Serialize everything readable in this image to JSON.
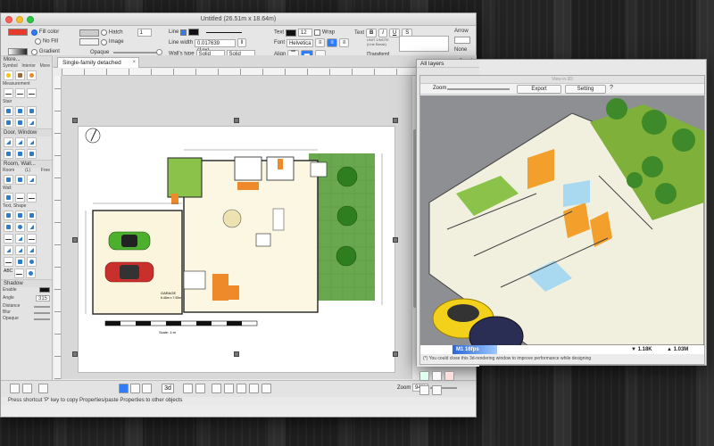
{
  "app": {
    "title": "Untitled (26.51m x 18.64m)",
    "status": "Press shortcut 'P' key to copy Properties/paste Properties to other objects"
  },
  "topbar": {
    "fill_color_label": "Fill color",
    "no_fill_label": "No Fill",
    "gradient_label": "Gradient",
    "hatch_label": "Hatch",
    "image_label": "Image",
    "opaque_label": "Opaque",
    "line_label": "Line",
    "line_width_label": "Line width",
    "line_width_value": "0.017639 (1px)",
    "walls_type_label": "Wall's type",
    "wall_type_1": "Solid wall...",
    "wall_type_2": "Solid wall...",
    "text_label": "Text",
    "font_label": "Font",
    "font_value": "Helvetica",
    "font_size": "12",
    "wrap_label": "Wrap",
    "align_label": "Align",
    "text_label2": "Text",
    "text_preview_1": "UNIT 1/NOTE",
    "text_preview_2": "(Line Break)",
    "transform_label": "[Transform]",
    "arrow_label": "Arrow",
    "arrow_none": "None",
    "hatch_count": "1"
  },
  "leftpanel": {
    "more_label": "More...",
    "symbol_label": "Symbol",
    "interior_label": "Interior",
    "more2_label": "More",
    "measurement_label": "Measurement",
    "stair_label": "Stair",
    "door_window_label": "Door, Window",
    "room_wall_label": "Room, Wall...",
    "room_label": "Room",
    "room_l_label": "(L)",
    "free_label": "Free",
    "wall_label": "Wall",
    "text_shape_label": "Text, Shape",
    "abc_label": "ABC",
    "shadow_label": "Shadow",
    "enable_label": "Enable",
    "angle_label": "Angle",
    "angle_value": "315",
    "distance_label": "Distance",
    "blur_label": "Blur",
    "opaque_label": "Opaque"
  },
  "tab": {
    "label": "Single-family detached home1"
  },
  "layers": {
    "title": "All layers",
    "add_label": "+"
  },
  "view3d": {
    "title": "View in 3D",
    "zoom_label": "Zoom",
    "export_label": "Export",
    "setting_label": "Setting",
    "help_label": "?",
    "fps_label": "M1 16fps",
    "stat1": "▼ 1.18K",
    "stat2": "▲ 1.03M",
    "hint": "(*) You could close this 3d-rendering window to improve performance while designing"
  },
  "bottombar": {
    "zoom_label": "Zoom",
    "zoom_value": "94%",
    "mode_3d": "3d"
  },
  "plan": {
    "scale_label": "Scale: 1:m",
    "room_garage": "GARAGE",
    "room_size": "6.46m x 7.92m"
  }
}
